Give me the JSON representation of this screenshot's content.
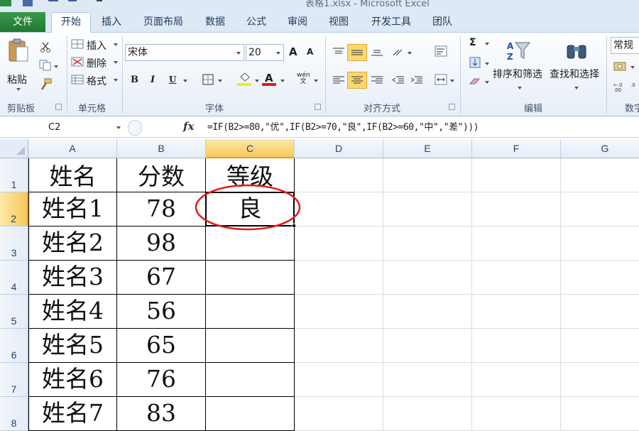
{
  "window": {
    "title": "表格1.xlsx - Microsoft Excel"
  },
  "ribbon": {
    "tabs": [
      "文件",
      "开始",
      "插入",
      "页面布局",
      "数据",
      "公式",
      "审阅",
      "视图",
      "开发工具",
      "团队"
    ],
    "clipboard": {
      "paste_label": "粘贴",
      "group_label": "剪贴板"
    },
    "cells_group": {
      "insert_label": "插入",
      "delete_label": "删除",
      "format_label": "格式",
      "group_label": "单元格"
    },
    "font": {
      "name": "宋体",
      "size": "20",
      "bold": "B",
      "italic": "I",
      "underline": "U",
      "group_label": "字体",
      "grow": "A",
      "shrink": "A",
      "color_letter": "A",
      "phonetic": "wén 文"
    },
    "alignment": {
      "group_label": "对齐方式"
    },
    "editing": {
      "sort_filter_label": "排序和筛选",
      "find_select_label": "查找和选择",
      "group_label": "编辑",
      "sum": "Σ"
    },
    "number": {
      "format": "常规",
      "group_label": "数字"
    },
    "colors": {
      "file_tab": "#217632",
      "highlight": "#fbd871",
      "font_color_bar": "#e21a1a",
      "fill_color_bar": "#f3f000"
    }
  },
  "formula_bar": {
    "name_box": "C2",
    "fx": "fx",
    "formula": "=IF(B2>=80,\"优\",IF(B2>=70,\"良\",IF(B2>=60,\"中\",\"差\")))"
  },
  "sheet": {
    "columns": [
      "A",
      "B",
      "C",
      "D",
      "E",
      "F",
      "G"
    ],
    "rows": [
      "1",
      "2",
      "3",
      "4",
      "5",
      "6",
      "7",
      "8"
    ],
    "cells": [
      [
        "姓名",
        "分数",
        "等级"
      ],
      [
        "姓名1",
        "78",
        "良"
      ],
      [
        "姓名2",
        "98",
        ""
      ],
      [
        "姓名3",
        "67",
        ""
      ],
      [
        "姓名4",
        "56",
        ""
      ],
      [
        "姓名5",
        "65",
        ""
      ],
      [
        "姓名6",
        "76",
        ""
      ],
      [
        "姓名7",
        "83",
        ""
      ]
    ],
    "selected_cell": "C2",
    "annotation_color": "#e11b1b"
  }
}
